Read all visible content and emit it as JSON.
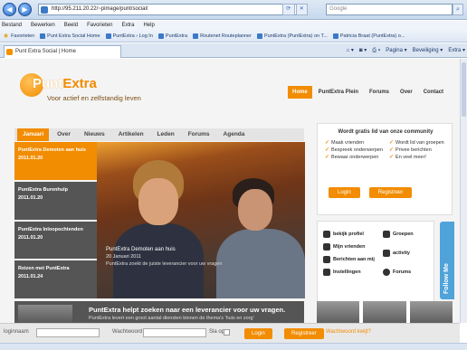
{
  "browser": {
    "address": "http://95.211.20.22/~pimage/punt/social/",
    "search_placeholder": "Google",
    "menu": [
      "Bestand",
      "Bewerken",
      "Beeld",
      "Favorieten",
      "Extra",
      "Help"
    ],
    "favorites_label": "Favorieten",
    "favorites": [
      "Punt Extra Social Home",
      "PuntExtra › Log In",
      "PuntExtra",
      "Routenet Routeplanner",
      "PuntExtra (PuntExtra) on T...",
      "Patricia Braat (PuntExtra) o..."
    ],
    "tab_title": "Punt Extra Social | Home",
    "commands": [
      "Pagina ▾",
      "Beveiliging ▾",
      "Extra ▾"
    ]
  },
  "site": {
    "logo": {
      "part1": "Punt",
      "part2": "Extra",
      "tagline": "Voor actief en zelfstandig leven"
    },
    "topnav": [
      "Home",
      "PuntExtra Plein",
      "Forums",
      "Over",
      "Contact"
    ],
    "subnav": [
      "Januari",
      "Over",
      "Nieuws",
      "Artikelen",
      "Leden",
      "Forums",
      "Agenda"
    ],
    "news": [
      {
        "title": "PuntExtra Demoten aan huis",
        "date": "2011.01.20"
      },
      {
        "title": "PuntExtra Burenhulp",
        "date": "2011.01.20"
      },
      {
        "title": "PuntExtra Inloopochtenden",
        "date": "2011.01.20"
      },
      {
        "title": "Reizen met PuntExtra",
        "date": "2011.01.24"
      }
    ],
    "feature": {
      "title": "PuntExtra Demoten aan huis",
      "date": "20 Januari 2011",
      "text": "PuntExtra zoekt de juiste leverancier voor uw vragen"
    },
    "promo": {
      "title": "PuntExtra helpt zoeken naar een leverancier voor uw vragen.",
      "text": "PuntExtra levert een groot aantal diensten binnen de thema's 'huis en zorg'"
    },
    "join": {
      "title": "Wordt gratis lid van onze community",
      "perks": [
        "Maak vrienden",
        "Wordt lid van groepen",
        "Bespreek onderwerpen",
        "Privee berichten",
        "Bewaar onderwerpen",
        "En veel meer!"
      ],
      "login": "Login",
      "register": "Registreer"
    },
    "links": [
      "bekijk profiel",
      "Groepen",
      "Mijn vrienden",
      "activity",
      "Berichten aan mij",
      "Instellingen",
      "Forums"
    ],
    "help_tab": "Follow Me"
  },
  "loginbar": {
    "username_label": "loginnaam",
    "password_label": "Wachtwoord",
    "remember_label": "Sla op",
    "login": "Login",
    "register": "Registreer",
    "forgot": "Wachtwoord kwijt?"
  }
}
